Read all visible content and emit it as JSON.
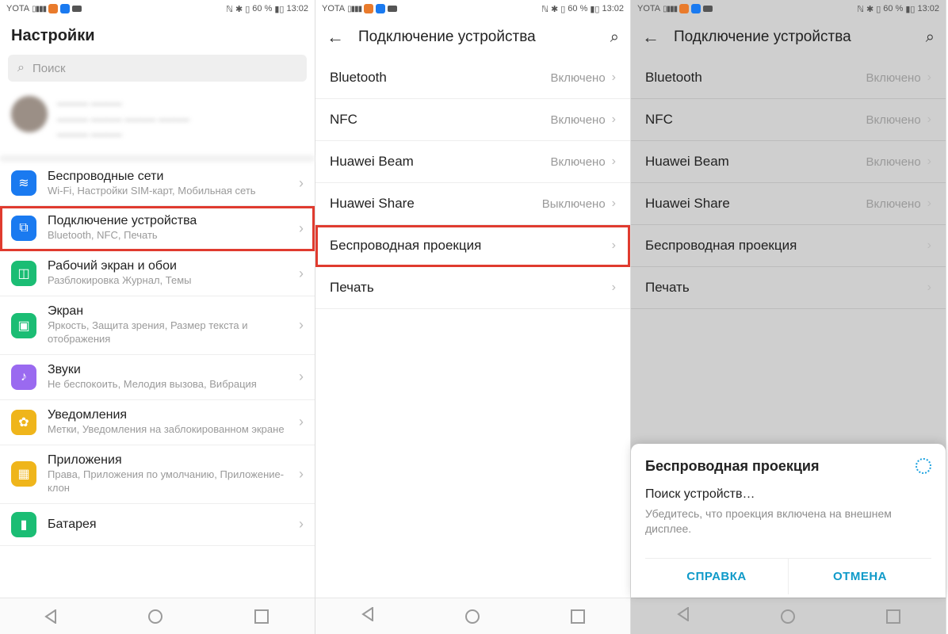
{
  "status": {
    "carrier": "YOTA",
    "battery": "60 %",
    "time": "13:02"
  },
  "s1": {
    "title": "Настройки",
    "search_placeholder": "Поиск",
    "items": [
      {
        "title": "Беспроводные сети",
        "sub": "Wi-Fi, Настройки SIM-карт, Мобильная сеть",
        "color": "#1a7af0",
        "glyph": "≋"
      },
      {
        "title": "Подключение устройства",
        "sub": "Bluetooth, NFC, Печать",
        "color": "#1a7af0",
        "glyph": "⧉",
        "hl": true
      },
      {
        "title": "Рабочий экран и обои",
        "sub": "Разблокировка Журнал, Темы",
        "color": "#1bbd74",
        "glyph": "◫"
      },
      {
        "title": "Экран",
        "sub": "Яркость, Защита зрения, Размер текста и отображения",
        "color": "#1bbd74",
        "glyph": "▣"
      },
      {
        "title": "Звуки",
        "sub": "Не беспокоить, Мелодия вызова, Вибрация",
        "color": "#9a6af0",
        "glyph": "♪"
      },
      {
        "title": "Уведомления",
        "sub": "Метки, Уведомления на заблокированном экране",
        "color": "#efb51b",
        "glyph": "✿"
      },
      {
        "title": "Приложения",
        "sub": "Права, Приложения по умолчанию, Приложение-клон",
        "color": "#efb51b",
        "glyph": "▦"
      },
      {
        "title": "Батарея",
        "sub": "",
        "color": "#1bbd74",
        "glyph": "▮"
      }
    ]
  },
  "s2": {
    "title": "Подключение устройства",
    "rows": [
      {
        "label": "Bluetooth",
        "value": "Включено"
      },
      {
        "label": "NFC",
        "value": "Включено"
      },
      {
        "label": "Huawei Beam",
        "value": "Включено"
      },
      {
        "label": "Huawei Share",
        "value": "Выключено"
      },
      {
        "label": "Беспроводная проекция",
        "value": "",
        "hl": true
      },
      {
        "label": "Печать",
        "value": ""
      }
    ]
  },
  "s3": {
    "title": "Подключение устройства",
    "rows": [
      {
        "label": "Bluetooth",
        "value": "Включено"
      },
      {
        "label": "NFC",
        "value": "Включено"
      },
      {
        "label": "Huawei Beam",
        "value": "Включено"
      },
      {
        "label": "Huawei Share",
        "value": "Включено"
      },
      {
        "label": "Беспроводная проекция",
        "value": ""
      },
      {
        "label": "Печать",
        "value": ""
      }
    ],
    "sheet": {
      "title": "Беспроводная проекция",
      "sub": "Поиск устройств…",
      "desc": "Убедитесь, что проекция включена на внешнем дисплее.",
      "help": "СПРАВКА",
      "cancel": "ОТМЕНА"
    }
  }
}
